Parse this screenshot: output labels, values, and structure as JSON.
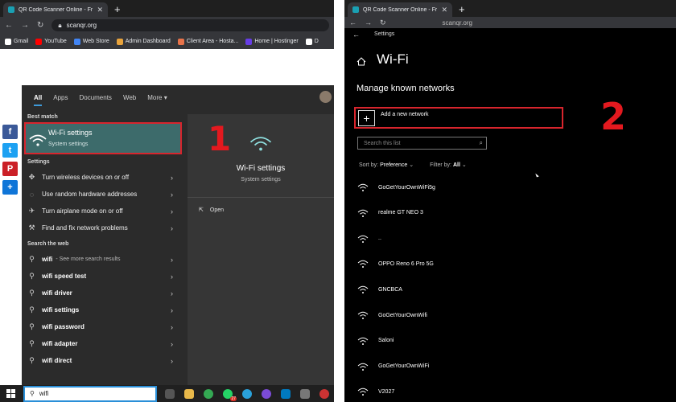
{
  "left_browser": {
    "tab_title": "QR Code Scanner Online - From",
    "url": "scanqr.org",
    "bookmarks": [
      {
        "label": "Gmail",
        "color": "#ffffff"
      },
      {
        "label": "YouTube",
        "color": "#ff0000"
      },
      {
        "label": "Web Store",
        "color": "#4285f4"
      },
      {
        "label": "Admin Dashboard",
        "color": "#e8a33c"
      },
      {
        "label": "Client Area - Hosta...",
        "color": "#e8734a"
      },
      {
        "label": "Home | Hostinger",
        "color": "#673de6"
      },
      {
        "label": "D",
        "color": "#ffffff"
      }
    ]
  },
  "share_buttons": [
    "f",
    "t",
    "P",
    "+"
  ],
  "start_menu": {
    "tabs": [
      "All",
      "Apps",
      "Documents",
      "Web",
      "More ▾"
    ],
    "best_match_heading": "Best match",
    "best_match_title": "Wi-Fi settings",
    "best_match_subtitle": "System settings",
    "settings_heading": "Settings",
    "settings_items": [
      "Turn wireless devices on or off",
      "Use random hardware addresses",
      "Turn airplane mode on or off",
      "Find and fix network problems"
    ],
    "web_heading": "Search the web",
    "web_items": [
      {
        "bold": "wifi",
        "rest": " - See more search results"
      },
      {
        "bold": "wifi speed test",
        "rest": ""
      },
      {
        "bold": "wifi driver",
        "rest": ""
      },
      {
        "bold": "wifi settings",
        "rest": ""
      },
      {
        "bold": "wifi password",
        "rest": ""
      },
      {
        "bold": "wifi adapter",
        "rest": ""
      },
      {
        "bold": "wifi direct",
        "rest": ""
      }
    ],
    "preview_title": "Wi-Fi settings",
    "preview_subtitle": "System settings",
    "open_label": "Open"
  },
  "taskbar": {
    "search_text": "wifi",
    "badge": "27"
  },
  "step_numbers": [
    "1",
    "2"
  ],
  "right_browser": {
    "tab_title": "QR Code Scanner Online - From",
    "url": "scanqr.org"
  },
  "settings": {
    "window_title": "Settings",
    "page_title": "Wi-Fi",
    "section_title": "Manage known networks",
    "add_network_label": "Add a new network",
    "search_placeholder": "Search this list",
    "sort_label": "Sort by:",
    "sort_value": "Preference",
    "filter_label": "Filter by:",
    "filter_value": "All",
    "networks": [
      "GoGetYourOwnWiFi5g",
      "realme GT NEO 3",
      "..",
      "OPPO Reno 6 Pro 5G",
      "GNCBCA",
      "GoGetYourOwnWifi",
      "Saloni",
      "GoGetYourOwnWiFi",
      "V2027"
    ]
  },
  "colors": {
    "highlight_red": "#d8252d",
    "accent_blue": "#3e9ad9",
    "best_match_bg": "#3d6b6b"
  }
}
